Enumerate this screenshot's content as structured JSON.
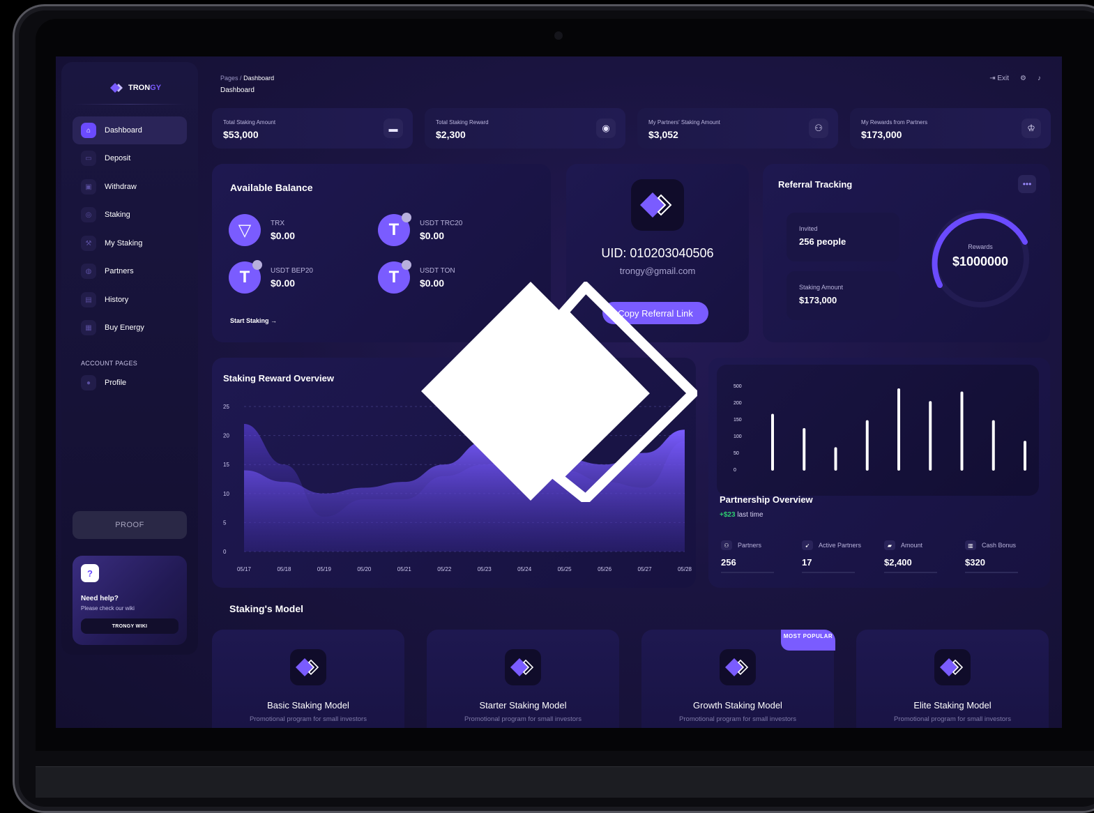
{
  "app": {
    "logo_text_a": "TRON",
    "logo_text_b": "GY"
  },
  "sidebar": {
    "items": [
      {
        "label": "Dashboard",
        "icon": "home-icon",
        "active": true
      },
      {
        "label": "Deposit",
        "icon": "card-icon"
      },
      {
        "label": "Withdraw",
        "icon": "wallet-icon"
      },
      {
        "label": "Staking",
        "icon": "coin-icon"
      },
      {
        "label": "My Staking",
        "icon": "wrench-icon"
      },
      {
        "label": "Partners",
        "icon": "globe-icon"
      },
      {
        "label": "History",
        "icon": "document-icon"
      },
      {
        "label": "Buy Energy",
        "icon": "calendar-icon"
      }
    ],
    "section_label": "ACCOUNT PAGES",
    "profile_label": "Profile",
    "proof_label": "PROOF",
    "help": {
      "title": "Need help?",
      "subtitle": "Please check our wiki",
      "button": "TRONGY WIKI"
    }
  },
  "header": {
    "breadcrumb_root": "Pages",
    "breadcrumb_sep": "/",
    "breadcrumb_current": "Dashboard",
    "title": "Dashboard",
    "exit_label": "Exit"
  },
  "stats": [
    {
      "label": "Total Staking Amount",
      "value": "$53,000",
      "icon": "wallet-icon"
    },
    {
      "label": "Total Staking Reward",
      "value": "$2,300",
      "icon": "coins-icon"
    },
    {
      "label": "My Partners' Staking Amount",
      "value": "$3,052",
      "icon": "users-icon"
    },
    {
      "label": "My Rewards from Partners",
      "value": "$173,000",
      "icon": "award-icon"
    }
  ],
  "balance": {
    "title": "Available Balance",
    "coins": [
      {
        "name": "TRX",
        "value": "$0.00"
      },
      {
        "name": "USDT TRC20",
        "value": "$0.00"
      },
      {
        "name": "USDT BEP20",
        "value": "$0.00"
      },
      {
        "name": "USDT TON",
        "value": "$0.00"
      }
    ],
    "start_link": "Start Staking"
  },
  "uid": {
    "uid_text": "UID: 010203040506",
    "email": "trongy@gmail.com",
    "button": "Copy Referral Link"
  },
  "referral": {
    "title": "Referral Tracking",
    "invited_label": "Invited",
    "invited_value": "256 people",
    "staking_label": "Staking Amount",
    "staking_value": "$173,000",
    "rewards_label": "Rewards",
    "rewards_value": "$1000000"
  },
  "reward_chart": {
    "title": "Staking Reward Overview"
  },
  "chart_data": [
    {
      "type": "area",
      "title": "Staking Reward Overview",
      "x": [
        "05/17",
        "05/18",
        "05/19",
        "05/20",
        "05/21",
        "05/22",
        "05/23",
        "05/24",
        "05/25",
        "05/26",
        "05/27",
        "05/28"
      ],
      "yticks": [
        25,
        20,
        15,
        10,
        5,
        0
      ],
      "ylim": [
        0,
        25
      ],
      "series": [
        {
          "values": [
            22,
            15,
            6,
            9,
            9,
            13,
            15,
            17,
            14,
            12,
            11,
            19
          ]
        },
        {
          "values": [
            14,
            12,
            10,
            11,
            12,
            15,
            19,
            21,
            16,
            15,
            17,
            21
          ]
        }
      ],
      "grid": true
    },
    {
      "type": "bar",
      "title": "",
      "yticks": [
        500,
        200,
        150,
        100,
        50,
        0
      ],
      "values": [
        340,
        250,
        130,
        300,
        500,
        420,
        480,
        300,
        170
      ],
      "ylim": [
        0,
        500
      ],
      "grid": false
    }
  ],
  "partnership": {
    "title": "Partnership Overview",
    "delta": "+$23",
    "delta_suffix": "last time",
    "stats": [
      {
        "label": "Partners",
        "value": "256",
        "icon": "users-icon"
      },
      {
        "label": "Active Partners",
        "value": "17",
        "icon": "rocket-icon"
      },
      {
        "label": "Amount",
        "value": "$2,400",
        "icon": "cart-icon"
      },
      {
        "label": "Cash Bonus",
        "value": "$320",
        "icon": "bonus-icon"
      }
    ]
  },
  "models": {
    "title": "Staking's Model",
    "items": [
      {
        "name": "Basic Staking Model",
        "desc": "Promotional program for small investors"
      },
      {
        "name": "Starter Staking Model",
        "desc": "Promotional program for small investors"
      },
      {
        "name": "Growth Staking Model",
        "desc": "Promotional program for small investors",
        "badge": "MOST POPULAR"
      },
      {
        "name": "Elite Staking Model",
        "desc": "Promotional program for small investors"
      }
    ]
  },
  "colors": {
    "accent": "#7a5cff",
    "background": "#1a1440",
    "positive": "#2ecc71"
  }
}
